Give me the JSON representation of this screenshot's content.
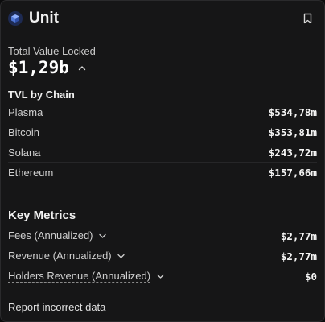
{
  "header": {
    "title": "Unit",
    "logo_icon": "unit-cube-logo",
    "bookmark_icon": "bookmark-icon"
  },
  "tvl": {
    "label": "Total Value Locked",
    "value": "$1,29b",
    "toggle_icon": "chevron-up-icon"
  },
  "tvl_by_chain": {
    "title": "TVL by Chain",
    "rows": [
      {
        "name": "Plasma",
        "value": "$534,78m"
      },
      {
        "name": "Bitcoin",
        "value": "$353,81m"
      },
      {
        "name": "Solana",
        "value": "$243,72m"
      },
      {
        "name": "Ethereum",
        "value": "$157,66m"
      }
    ]
  },
  "key_metrics": {
    "title": "Key Metrics",
    "rows": [
      {
        "label": "Fees (Annualized)",
        "value": "$2,77m"
      },
      {
        "label": "Revenue (Annualized)",
        "value": "$2,77m"
      },
      {
        "label": "Holders Revenue (Annualized)",
        "value": "$0"
      }
    ]
  },
  "footer": {
    "report_link": "Report incorrect data"
  },
  "colors": {
    "background": "#161617",
    "border": "#2a2a2c",
    "logo_bg": "#1d2a52",
    "logo_accent": "#5b8def"
  }
}
